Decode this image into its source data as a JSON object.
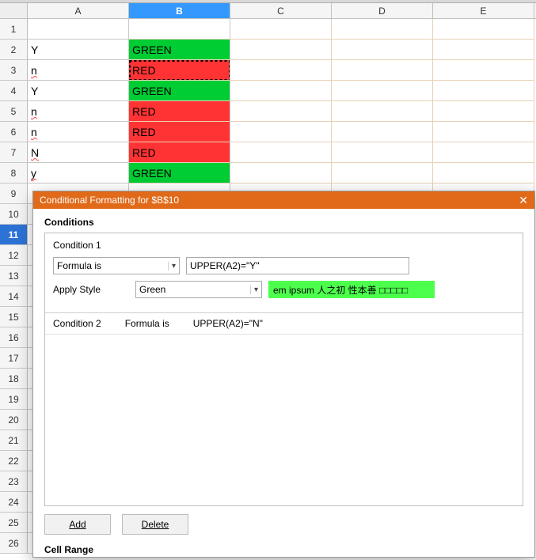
{
  "columns": [
    "A",
    "B",
    "C",
    "D",
    "E"
  ],
  "selected_col_index": 1,
  "selected_row": 11,
  "row_count": 26,
  "cells": {
    "r2": {
      "a": "Y",
      "b": "GREEN",
      "b_fmt": "green"
    },
    "r3": {
      "a": "n",
      "a_spell": true,
      "b": "RED",
      "b_fmt": "red",
      "b_sel": true
    },
    "r4": {
      "a": "Y",
      "b": "GREEN",
      "b_fmt": "green"
    },
    "r5": {
      "a": "n",
      "a_spell": true,
      "b": "RED",
      "b_fmt": "red"
    },
    "r6": {
      "a": "n",
      "a_spell": true,
      "b": "RED",
      "b_fmt": "red"
    },
    "r7": {
      "a": "N",
      "a_spell": true,
      "b": "RED",
      "b_fmt": "red"
    },
    "r8": {
      "a": "y",
      "a_spell": true,
      "b": "GREEN",
      "b_fmt": "green"
    }
  },
  "dialog": {
    "title": "Conditional Formatting for $B$10",
    "sect_conditions": "Conditions",
    "cond1": {
      "title": "Condition 1",
      "type_label": "Formula is",
      "formula": "UPPER(A2)=\"Y\"",
      "apply_label": "Apply Style",
      "style_value": "Green",
      "preview": "em ipsum   人之初 性本善   □□□□□"
    },
    "cond2": {
      "title": "Condition 2",
      "type_label": "Formula is",
      "formula": "UPPER(A2)=\"N\""
    },
    "btn_add": "Add",
    "btn_delete": "Delete",
    "sect_range": "Cell Range"
  }
}
